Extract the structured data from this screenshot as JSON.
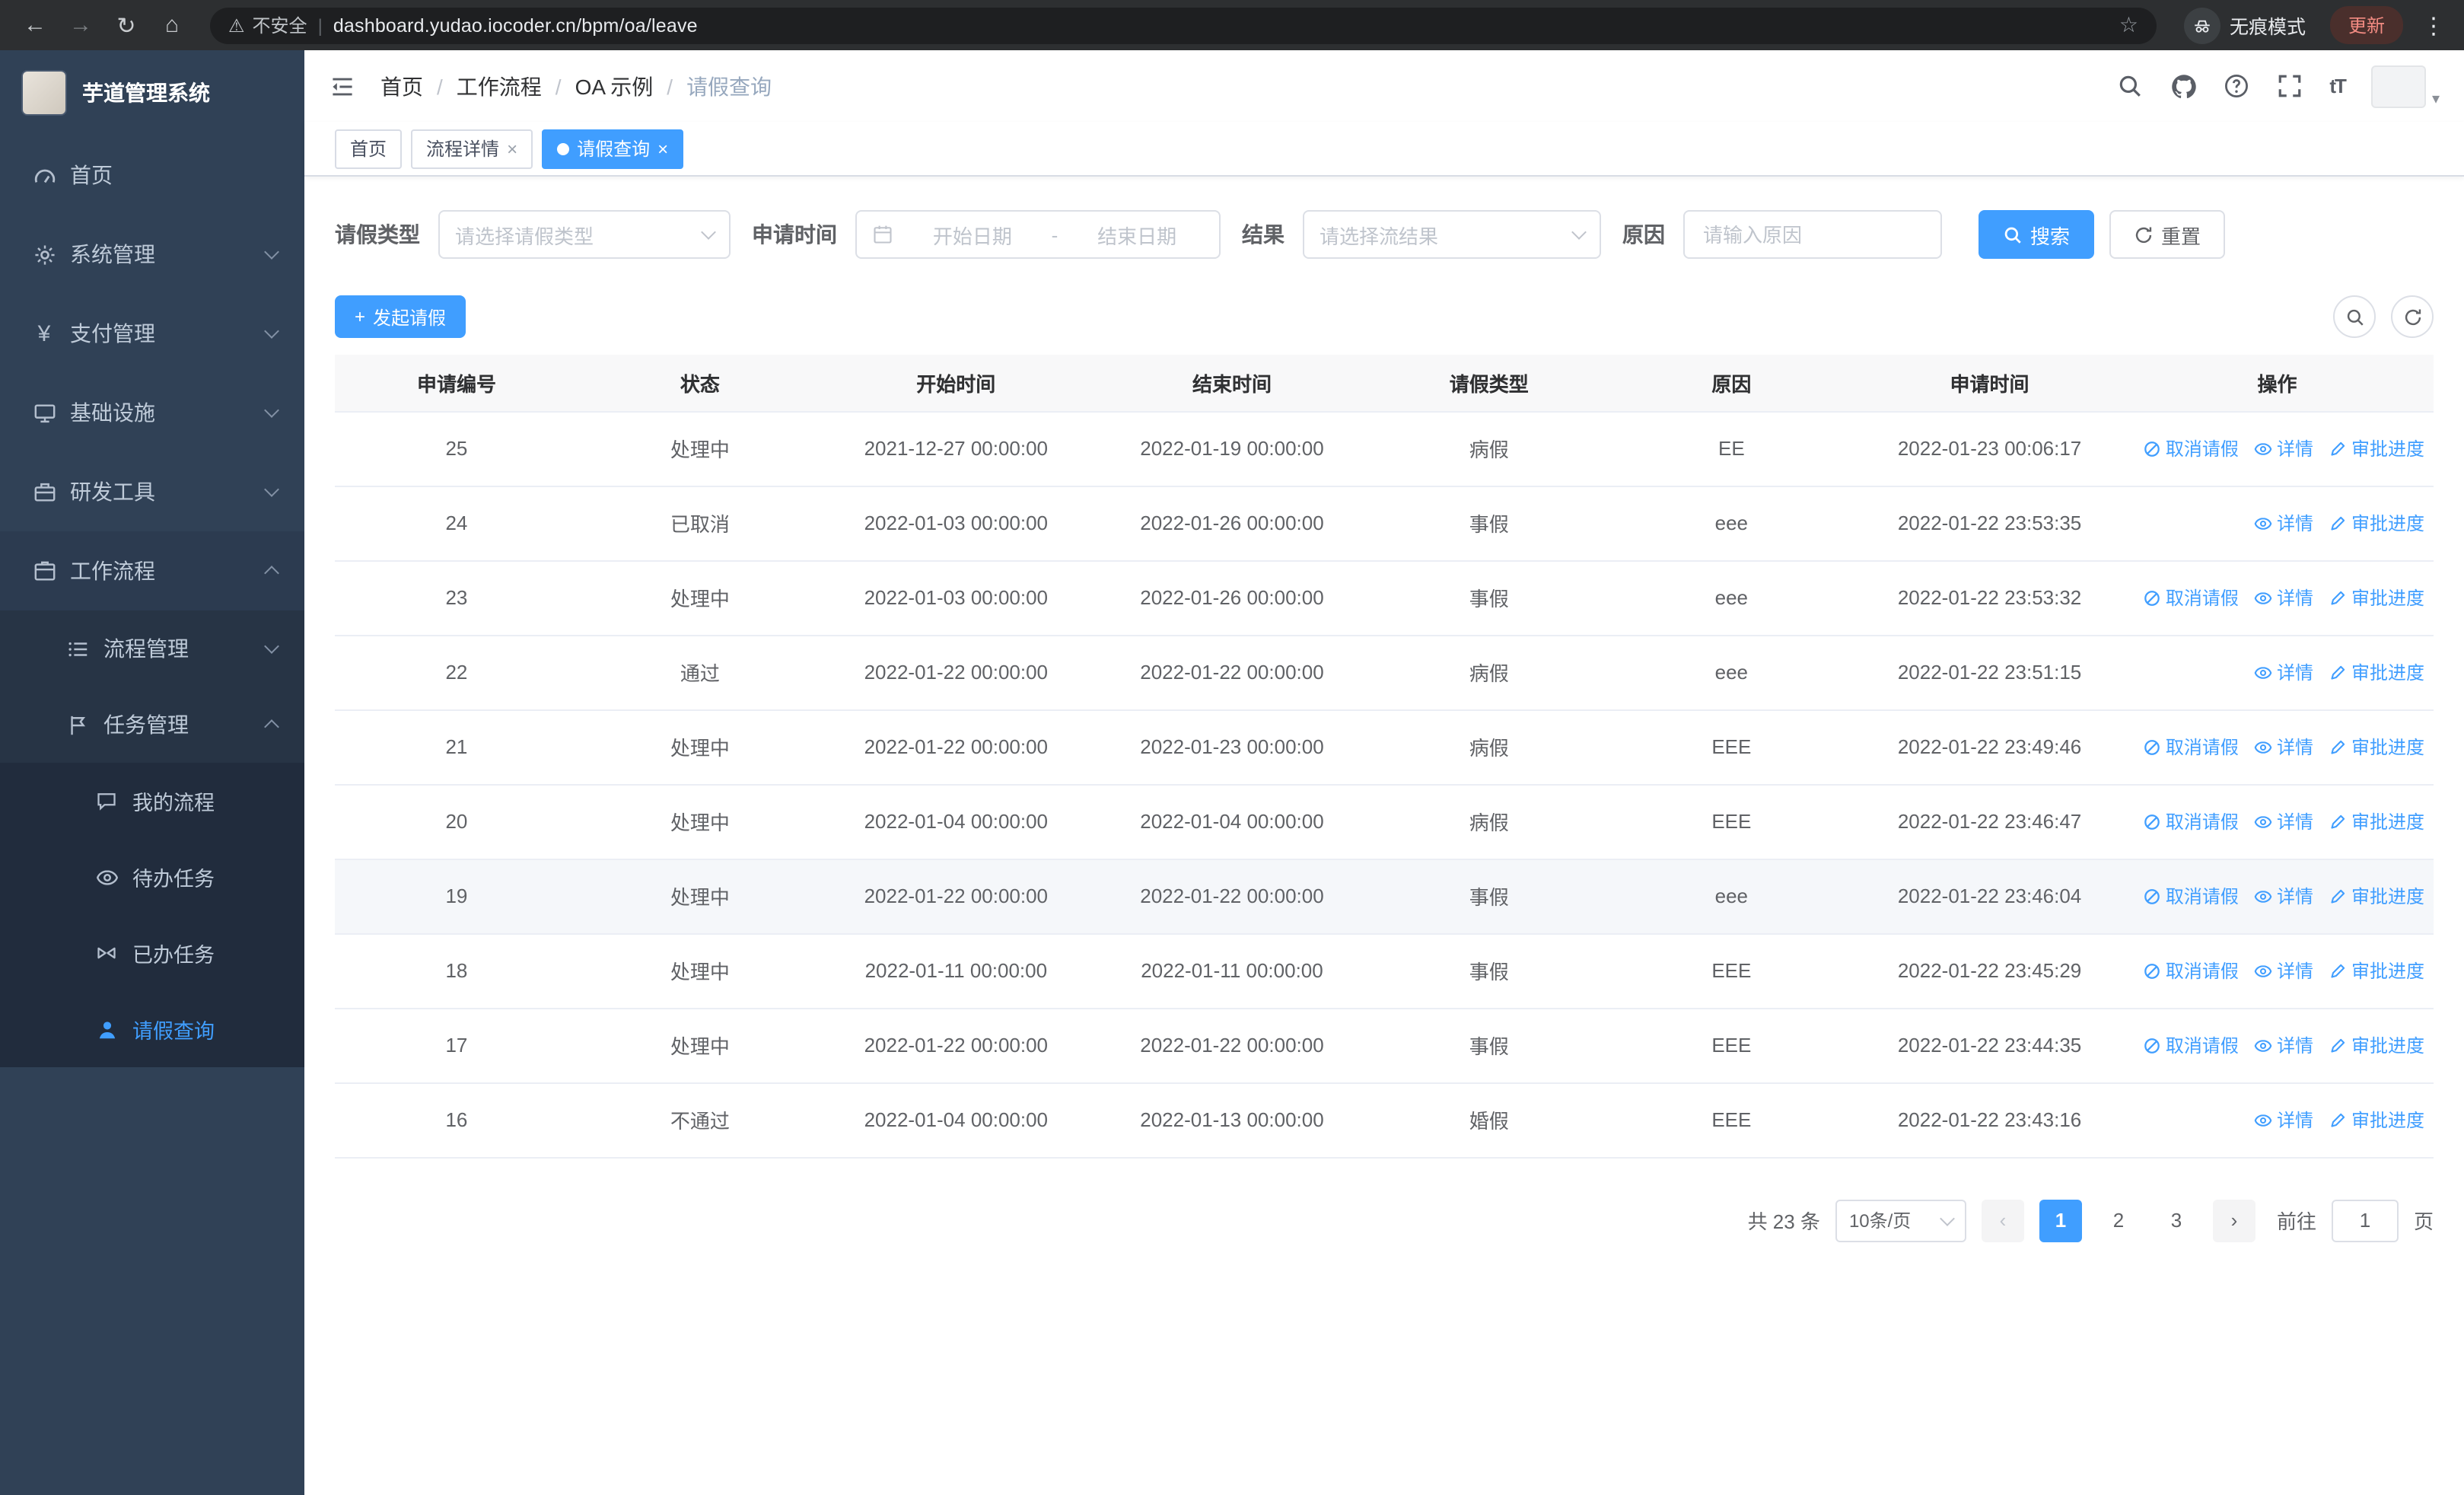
{
  "icons": {
    "back": "←",
    "forward": "→",
    "reload": "↻",
    "home": "⌂",
    "warning": "⚠",
    "star": "☆",
    "kebab": "⋮",
    "caret_down": "▾",
    "yen": "¥",
    "font_size": "tT",
    "plus": "+",
    "dash": "-",
    "prev": "‹",
    "next": "›"
  },
  "browser": {
    "security_warning": "不安全",
    "url": "dashboard.yudao.iocoder.cn/bpm/oa/leave",
    "incognito_label": "无痕模式",
    "update_label": "更新"
  },
  "sidebar": {
    "app_title": "芋道管理系统",
    "items": [
      {
        "label": "首页"
      },
      {
        "label": "系统管理"
      },
      {
        "label": "支付管理"
      },
      {
        "label": "基础设施"
      },
      {
        "label": "研发工具"
      },
      {
        "label": "工作流程"
      }
    ],
    "workflow_children": [
      {
        "label": "流程管理"
      },
      {
        "label": "任务管理"
      }
    ],
    "task_children": [
      {
        "label": "我的流程"
      },
      {
        "label": "待办任务"
      },
      {
        "label": "已办任务"
      },
      {
        "label": "请假查询"
      }
    ]
  },
  "breadcrumb": {
    "separator": "/",
    "items": [
      "首页",
      "工作流程",
      "OA 示例",
      "请假查询"
    ]
  },
  "tabs": {
    "close_symbol": "×",
    "list": [
      {
        "label": "首页"
      },
      {
        "label": "流程详情"
      },
      {
        "label": "请假查询"
      }
    ]
  },
  "filters": {
    "leave_type_label": "请假类型",
    "leave_type_placeholder": "请选择请假类型",
    "apply_time_label": "申请时间",
    "start_date_placeholder": "开始日期",
    "end_date_placeholder": "结束日期",
    "result_label": "结果",
    "result_placeholder": "请选择流结果",
    "reason_label": "原因",
    "reason_placeholder": "请输入原因",
    "search_button": "搜索",
    "reset_button": "重置"
  },
  "toolbar": {
    "create_button": "发起请假"
  },
  "table": {
    "columns": [
      "申请编号",
      "状态",
      "开始时间",
      "结束时间",
      "请假类型",
      "原因",
      "申请时间",
      "操作"
    ],
    "action_labels": {
      "cancel": "取消请假",
      "detail": "详情",
      "progress": "审批进度"
    },
    "rows": [
      {
        "id": "25",
        "status": "处理中",
        "start": "2021-12-27 00:00:00",
        "end": "2022-01-19 00:00:00",
        "type": "病假",
        "reason": "EE",
        "apply_time": "2022-01-23 00:06:17",
        "actions": [
          "cancel",
          "detail",
          "progress"
        ],
        "highlighted": false
      },
      {
        "id": "24",
        "status": "已取消",
        "start": "2022-01-03 00:00:00",
        "end": "2022-01-26 00:00:00",
        "type": "事假",
        "reason": "eee",
        "apply_time": "2022-01-22 23:53:35",
        "actions": [
          "detail",
          "progress"
        ],
        "highlighted": false
      },
      {
        "id": "23",
        "status": "处理中",
        "start": "2022-01-03 00:00:00",
        "end": "2022-01-26 00:00:00",
        "type": "事假",
        "reason": "eee",
        "apply_time": "2022-01-22 23:53:32",
        "actions": [
          "cancel",
          "detail",
          "progress"
        ],
        "highlighted": false
      },
      {
        "id": "22",
        "status": "通过",
        "start": "2022-01-22 00:00:00",
        "end": "2022-01-22 00:00:00",
        "type": "病假",
        "reason": "eee",
        "apply_time": "2022-01-22 23:51:15",
        "actions": [
          "detail",
          "progress"
        ],
        "highlighted": false
      },
      {
        "id": "21",
        "status": "处理中",
        "start": "2022-01-22 00:00:00",
        "end": "2022-01-23 00:00:00",
        "type": "病假",
        "reason": "EEE",
        "apply_time": "2022-01-22 23:49:46",
        "actions": [
          "cancel",
          "detail",
          "progress"
        ],
        "highlighted": false
      },
      {
        "id": "20",
        "status": "处理中",
        "start": "2022-01-04 00:00:00",
        "end": "2022-01-04 00:00:00",
        "type": "病假",
        "reason": "EEE",
        "apply_time": "2022-01-22 23:46:47",
        "actions": [
          "cancel",
          "detail",
          "progress"
        ],
        "highlighted": false
      },
      {
        "id": "19",
        "status": "处理中",
        "start": "2022-01-22 00:00:00",
        "end": "2022-01-22 00:00:00",
        "type": "事假",
        "reason": "eee",
        "apply_time": "2022-01-22 23:46:04",
        "actions": [
          "cancel",
          "detail",
          "progress"
        ],
        "highlighted": true
      },
      {
        "id": "18",
        "status": "处理中",
        "start": "2022-01-11 00:00:00",
        "end": "2022-01-11 00:00:00",
        "type": "事假",
        "reason": "EEE",
        "apply_time": "2022-01-22 23:45:29",
        "actions": [
          "cancel",
          "detail",
          "progress"
        ],
        "highlighted": false
      },
      {
        "id": "17",
        "status": "处理中",
        "start": "2022-01-22 00:00:00",
        "end": "2022-01-22 00:00:00",
        "type": "事假",
        "reason": "EEE",
        "apply_time": "2022-01-22 23:44:35",
        "actions": [
          "cancel",
          "detail",
          "progress"
        ],
        "highlighted": false
      },
      {
        "id": "16",
        "status": "不通过",
        "start": "2022-01-04 00:00:00",
        "end": "2022-01-13 00:00:00",
        "type": "婚假",
        "reason": "EEE",
        "apply_time": "2022-01-22 23:43:16",
        "actions": [
          "detail",
          "progress"
        ],
        "highlighted": false
      }
    ]
  },
  "pagination": {
    "total_text": "共 23 条",
    "page_size": "10条/页",
    "pages": [
      "1",
      "2",
      "3"
    ],
    "goto_label": "前往",
    "goto_value": "1",
    "goto_suffix": "页"
  }
}
